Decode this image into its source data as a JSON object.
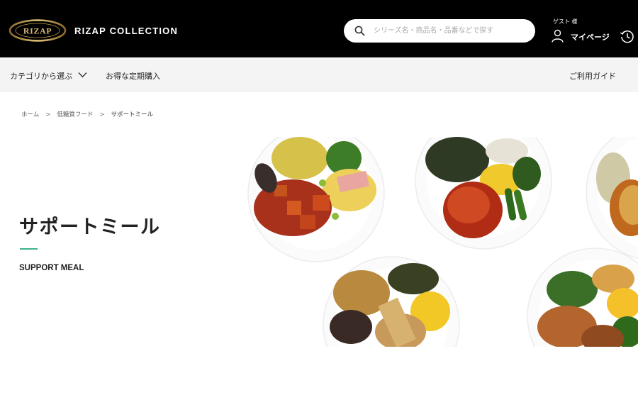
{
  "header": {
    "logo_text": "RIZAP",
    "brand": "RIZAP COLLECTION",
    "search_placeholder": "シリーズ名・商品名・品番などで探す",
    "guest_label": "ゲスト 様",
    "mypage_label": "マイページ"
  },
  "nav": {
    "category_label": "カテゴリから選ぶ",
    "subscription_label": "お得な定期購入",
    "guide_label": "ご利用ガイド"
  },
  "breadcrumb": [
    "ホーム",
    "低糖質フード",
    "サポートミール"
  ],
  "breadcrumb_separator": ">",
  "hero": {
    "title": "サポートミール",
    "subtitle": "SUPPORT MEAL",
    "accent_color": "#3cb38a"
  },
  "icons": [
    "search-icon",
    "user-icon",
    "history-icon",
    "chevron-down-icon"
  ]
}
